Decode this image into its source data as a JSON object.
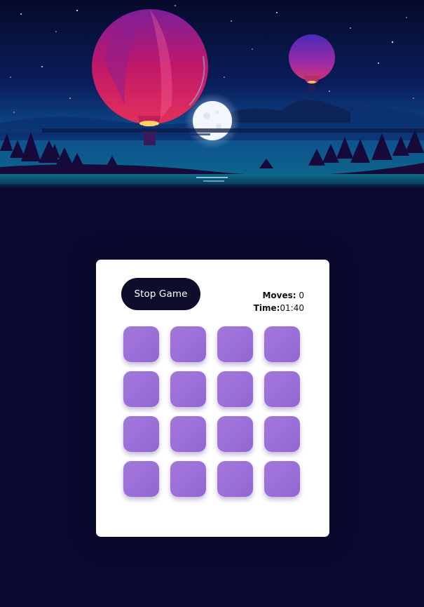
{
  "header_image": {
    "description_icon": "hot-air-balloons-night-scene"
  },
  "controls": {
    "stop_label": "Stop Game"
  },
  "stats": {
    "moves_label": "Moves:",
    "moves_value": "0",
    "time_label": "Time:",
    "time_value": "01:40"
  },
  "board": {
    "rows": 4,
    "cols": 4,
    "tiles_face_down": 16
  },
  "colors": {
    "page_background": "#0a0a31",
    "card_background": "#ffffff",
    "button_background": "#0f0d2c",
    "tile_color": "#9b6fd9"
  }
}
